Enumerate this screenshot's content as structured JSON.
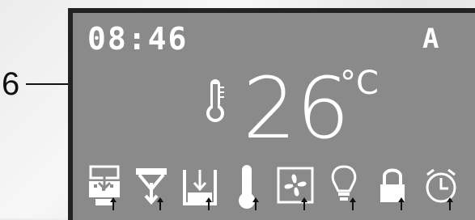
{
  "callout": {
    "label": "6"
  },
  "display": {
    "time": "08:46",
    "mode": "A",
    "temperature": "26",
    "unit": "°C"
  },
  "icons": [
    "defrost-icon",
    "drip-icon",
    "water-level-icon",
    "thermometer-icon",
    "fan-icon",
    "light-bulb-icon",
    "lock-icon",
    "timer-icon"
  ],
  "colors": {
    "screen": "#8a8a8a",
    "bezel": "#222222",
    "text": "#ffffff"
  }
}
